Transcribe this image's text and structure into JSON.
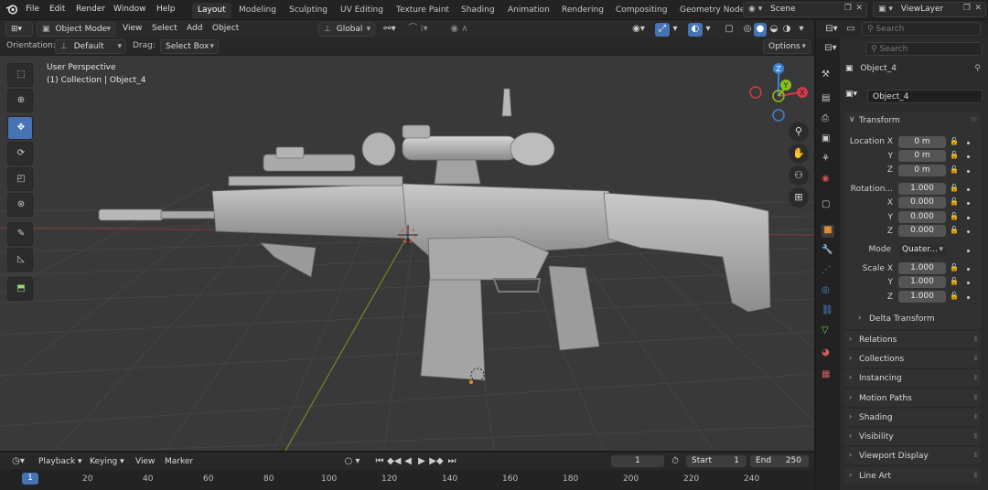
{
  "topbar": {
    "menus": [
      "File",
      "Edit",
      "Render",
      "Window",
      "Help"
    ],
    "workspaces": [
      "Layout",
      "Modeling",
      "Sculpting",
      "UV Editing",
      "Texture Paint",
      "Shading",
      "Animation",
      "Rendering",
      "Compositing",
      "Geometry Node"
    ],
    "active_workspace": "Layout",
    "scene": "Scene",
    "view_layer": "ViewLayer"
  },
  "viewport_header": {
    "mode": "Object Mode",
    "menus": [
      "View",
      "Select",
      "Add",
      "Object"
    ],
    "transform_orientation": "Global"
  },
  "tool_header": {
    "orientation_label": "Orientation:",
    "orientation_value": "Default",
    "drag_label": "Drag:",
    "drag_value": "Select Box",
    "options": "Options"
  },
  "viewport": {
    "perspective": "User Perspective",
    "collection": "(1) Collection | Object_4",
    "gizmo_axes": [
      "Z",
      "Y",
      "X"
    ]
  },
  "outliner": {
    "search_placeholder": "Search"
  },
  "properties": {
    "search_placeholder": "Search",
    "object_name": "Object_4",
    "object_field": "Object_4",
    "transform_title": "Transform",
    "location": {
      "label": "Location X",
      "x": "0 m",
      "y": "0 m",
      "z": "0 m"
    },
    "rotation": {
      "label": "Rotation...",
      "w": "1.000",
      "x": "0.000",
      "y": "0.000",
      "z": "0.000"
    },
    "axis_labels": {
      "x": "X",
      "y": "Y",
      "z": "Z",
      "w": "W"
    },
    "mode": {
      "label": "Mode",
      "value": "Quater..."
    },
    "scale": {
      "label": "Scale X",
      "x": "1.000",
      "y": "1.000",
      "z": "1.000"
    },
    "delta_transform": "Delta Transform",
    "panels": [
      "Relations",
      "Collections",
      "Instancing",
      "Motion Paths",
      "Shading",
      "Visibility",
      "Viewport Display",
      "Line Art"
    ]
  },
  "timeline": {
    "menus": [
      "Playback",
      "Keying",
      "View",
      "Marker"
    ],
    "current_frame": "1",
    "start_label": "Start",
    "start_value": "1",
    "end_label": "End",
    "end_value": "250",
    "ruler": [
      "1",
      "20",
      "40",
      "60",
      "80",
      "100",
      "120",
      "140",
      "160",
      "180",
      "200",
      "220",
      "240"
    ]
  },
  "colors": {
    "accent": "#4772b3",
    "axis_x": "#d33a4a",
    "axis_y": "#8cbf1f",
    "axis_z": "#3c82d8",
    "object_orange": "#e08b35"
  }
}
